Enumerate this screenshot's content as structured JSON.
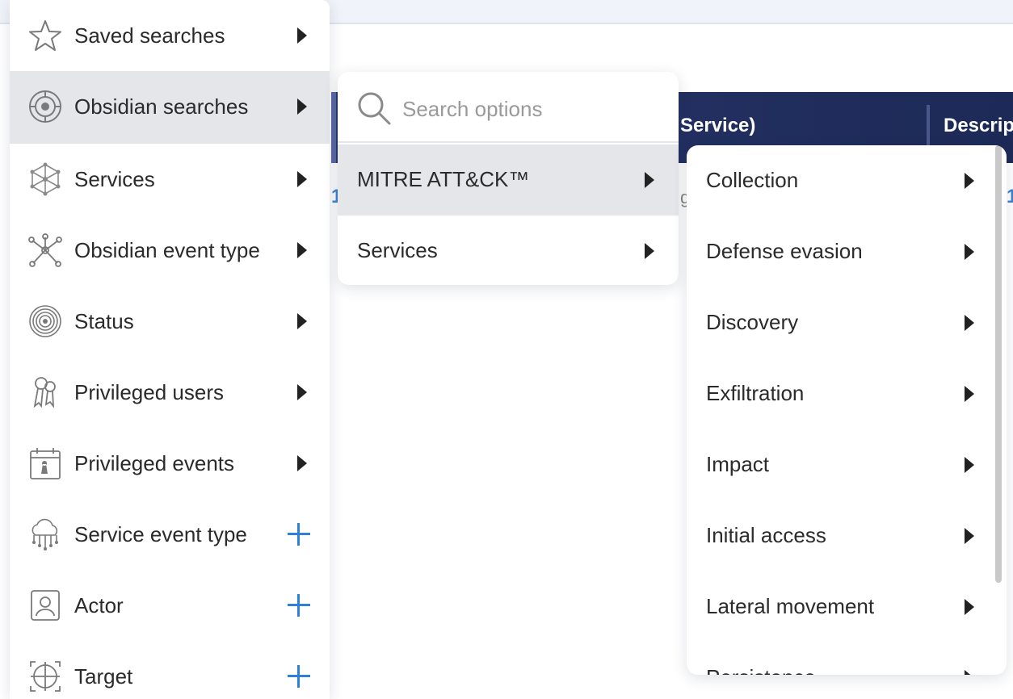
{
  "background": {
    "table_header": {
      "col_service": "Service)",
      "col_description": "Description"
    },
    "row_partial": {
      "left_fragment": "1",
      "mid_fragment": "g",
      "right_fragment": "1"
    }
  },
  "main_menu": {
    "items": [
      {
        "label": "Saved searches",
        "icon": "star-icon",
        "trailing": "arrow"
      },
      {
        "label": "Obsidian searches",
        "icon": "obsidian-logo-icon",
        "trailing": "arrow",
        "active": true
      },
      {
        "label": "Services",
        "icon": "network-icon",
        "trailing": "arrow"
      },
      {
        "label": "Obsidian event type",
        "icon": "node-graph-icon",
        "trailing": "arrow"
      },
      {
        "label": "Status",
        "icon": "target-rings-icon",
        "trailing": "arrow"
      },
      {
        "label": "Privileged users",
        "icon": "keys-icon",
        "trailing": "arrow"
      },
      {
        "label": "Privileged events",
        "icon": "calendar-keys-icon",
        "trailing": "arrow"
      },
      {
        "label": "Service event type",
        "icon": "cloud-circuit-icon",
        "trailing": "plus"
      },
      {
        "label": "Actor",
        "icon": "user-card-icon",
        "trailing": "plus"
      },
      {
        "label": "Target",
        "icon": "crosshair-icon",
        "trailing": "plus"
      }
    ]
  },
  "sub_menu": {
    "search_placeholder": "Search options",
    "items": [
      {
        "label": "MITRE ATT&CK™",
        "active": true
      },
      {
        "label": "Services"
      }
    ]
  },
  "tactics_menu": {
    "items": [
      {
        "label": "Collection"
      },
      {
        "label": "Defense evasion"
      },
      {
        "label": "Discovery"
      },
      {
        "label": "Exfiltration"
      },
      {
        "label": "Impact"
      },
      {
        "label": "Initial access"
      },
      {
        "label": "Lateral movement"
      },
      {
        "label": "Persistence"
      }
    ]
  },
  "colors": {
    "accent": "#2f80d8",
    "header_bg": "#1d2a57",
    "active_row": "#e5e6ea"
  }
}
